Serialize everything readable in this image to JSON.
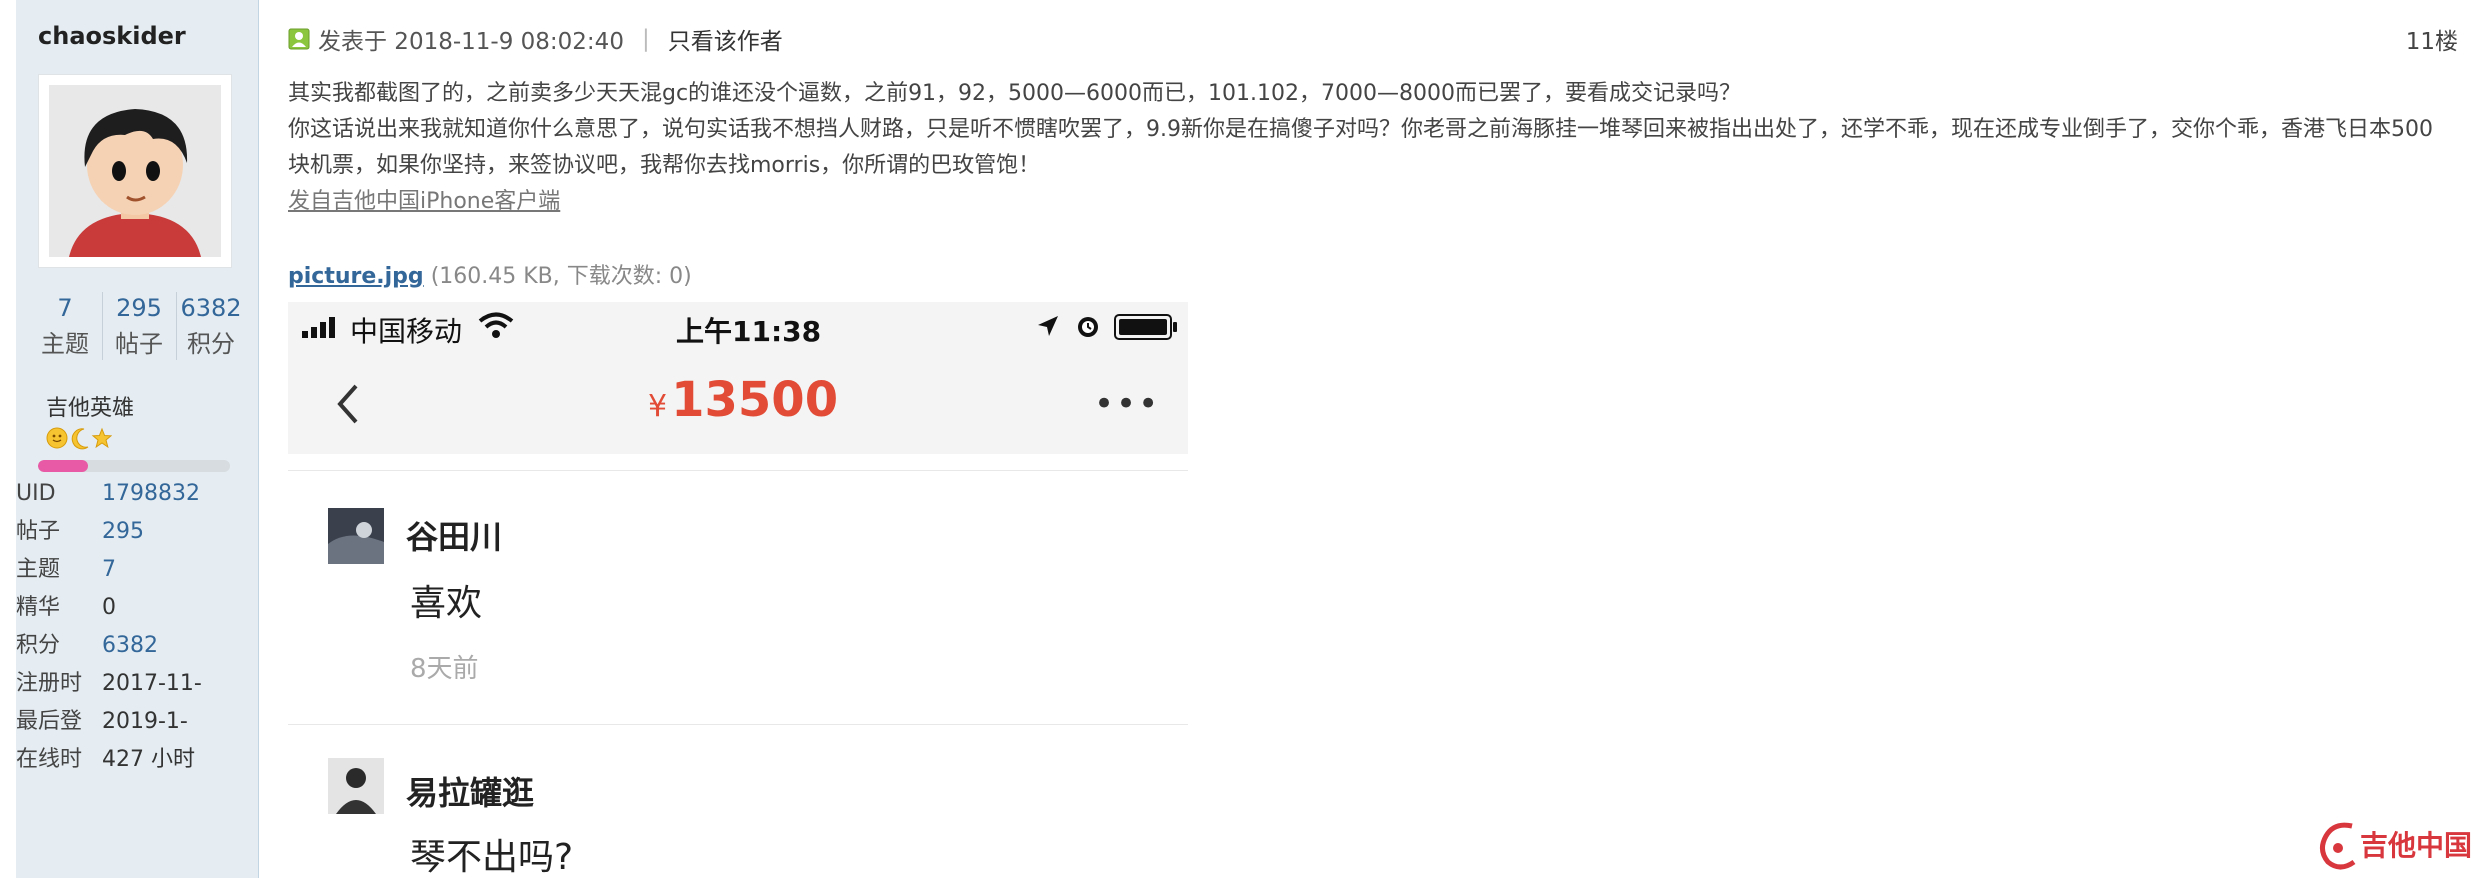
{
  "sidebar": {
    "username": "chaoskider",
    "stats": [
      {
        "value": "7",
        "label": "主题"
      },
      {
        "value": "295",
        "label": "帖子"
      },
      {
        "value": "6382",
        "label": "积分"
      }
    ],
    "rank": "吉他英雄",
    "rank_progress": 0.26,
    "info": [
      {
        "key": "UID",
        "value": "1798832"
      },
      {
        "key": "帖子",
        "value": "295"
      },
      {
        "key": "主题",
        "value": "7"
      },
      {
        "key": "精华",
        "value": "0"
      },
      {
        "key": "积分",
        "value": "6382"
      },
      {
        "key": "注册时",
        "value": "2017-11-"
      },
      {
        "key": "最后登",
        "value": "2019-1-"
      },
      {
        "key": "在线时",
        "value": "427 小时"
      }
    ]
  },
  "post": {
    "posted_label": "发表于 2018-11-9 08:02:40",
    "author_only": "只看该作者",
    "floor": "11楼",
    "paragraph1": "其实我都截图了的，之前卖多少天天混gc的谁还没个逼数，之前91，92，5000—6000而已，101.102，7000—8000而已罢了，要看成交记录吗？",
    "paragraph2": "你这话说出来我就知道你什么意思了，说句实话我不想挡人财路，只是听不惯瞎吹罢了，9.9新你是在搞傻子对吗？你老哥之前海豚挂一堆琴回来被指出出处了，还学不乖，现在还成专业倒手了，交你个乖，香港飞日本500块机票，如果你坚持，来签协议吧，我帮你去找morris，你所谓的巴玫管饱！",
    "source": "发自吉他中国iPhone客户端",
    "attachment_name": "picture.jpg",
    "attachment_meta": "(160.45 KB, 下载次数: 0)"
  },
  "phone": {
    "carrier": "中国移动",
    "time": "上午11:38",
    "price_symbol": "¥",
    "price": "13500",
    "comments": [
      {
        "name": "谷田川",
        "text": "喜欢",
        "time": "8天前"
      },
      {
        "name": "易拉罐逛",
        "text": "琴不出吗?"
      }
    ]
  },
  "watermark": {
    "text": "吉他中国"
  },
  "colors": {
    "sidebar_bg": "#e5edf2",
    "link": "#336699",
    "price": "#e24b35",
    "progress": "#e85aa5",
    "watermark": "#d8373e"
  }
}
